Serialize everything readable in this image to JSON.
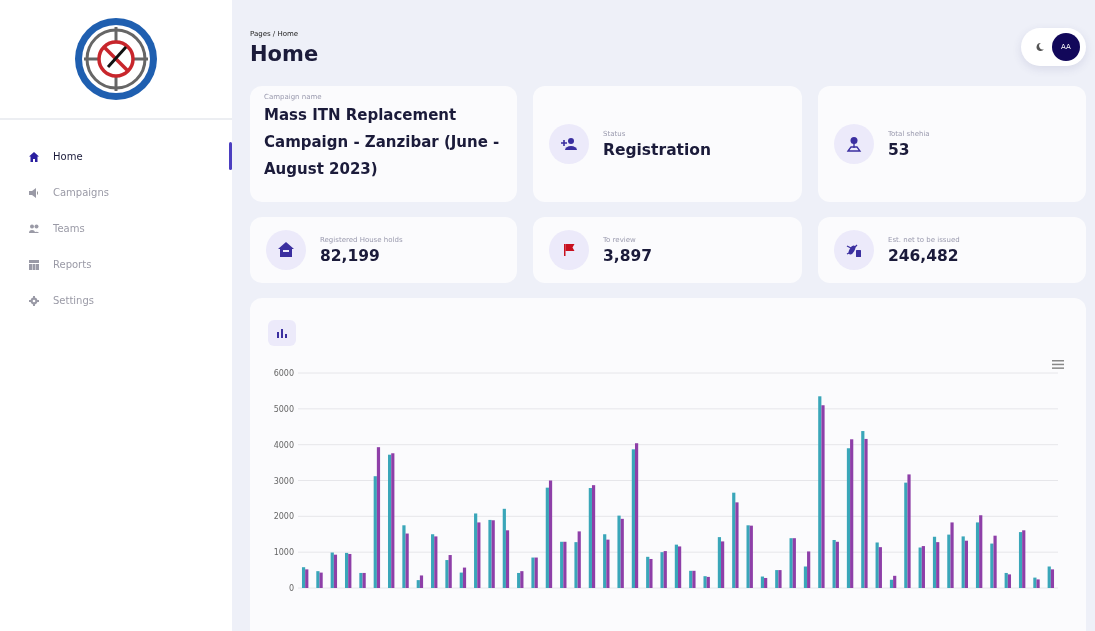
{
  "sidebar": {
    "items": [
      {
        "label": "Home",
        "selected": true
      },
      {
        "label": "Campaigns",
        "selected": false
      },
      {
        "label": "Teams",
        "selected": false
      },
      {
        "label": "Reports",
        "selected": false
      },
      {
        "label": "Settings",
        "selected": false
      }
    ]
  },
  "header": {
    "breadcrumb": "Pages / Home",
    "title": "Home",
    "avatar": "AA"
  },
  "campaign": {
    "label": "Campaign name",
    "value": "Mass ITN Replacement Campaign - Zanzibar (June - August 2023)"
  },
  "stats": [
    {
      "label": "Status",
      "value": "Registration"
    },
    {
      "label": "Total shehia",
      "value": "53"
    },
    {
      "label": "Registered House holds",
      "value": "82,199"
    },
    {
      "label": "To review",
      "value": "3,897"
    },
    {
      "label": "Est. net to be issued",
      "value": "246,482"
    }
  ],
  "chart": {
    "chart_data": {
      "type": "bar",
      "grid": true,
      "ylim": [
        0,
        6000
      ],
      "yticks": [
        0,
        1000,
        2000,
        3000,
        4000,
        5000,
        6000
      ],
      "series": [
        {
          "color": "#3aa6b9",
          "values": [
            580,
            470,
            990,
            980,
            420,
            3120,
            3720,
            1750,
            220,
            1500,
            780,
            430,
            2080,
            1900,
            2210,
            420,
            850,
            2800,
            1290,
            1280,
            2790,
            1500,
            2020,
            3870,
            870,
            1000,
            1210,
            480,
            330,
            1420,
            2660,
            1750,
            320,
            500,
            1390,
            600,
            5350,
            1340,
            3900,
            4380,
            1270,
            230,
            2940,
            1130,
            1430,
            1490,
            1440,
            1830,
            1240,
            420,
            1560,
            290,
            600
          ]
        },
        {
          "color": "#8e3fa8",
          "values": [
            520,
            430,
            930,
            950,
            420,
            3930,
            3760,
            1520,
            350,
            1440,
            920,
            570,
            1830,
            1890,
            1610,
            470,
            850,
            3000,
            1290,
            1580,
            2870,
            1350,
            1930,
            4040,
            810,
            1030,
            1160,
            480,
            310,
            1300,
            2390,
            1740,
            280,
            500,
            1390,
            1020,
            5100,
            1290,
            4150,
            4160,
            1140,
            340,
            3170,
            1170,
            1280,
            1830,
            1320,
            2030,
            1460,
            380,
            1610,
            240,
            520
          ]
        }
      ]
    }
  }
}
